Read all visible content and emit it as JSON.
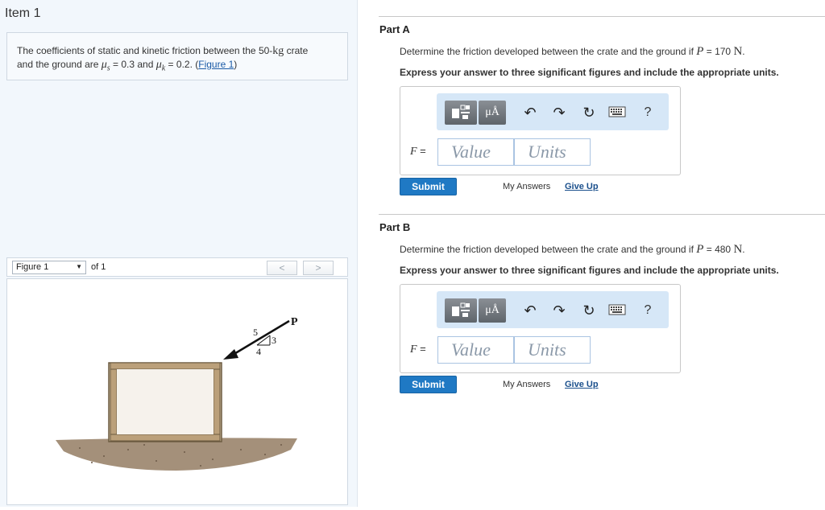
{
  "item_title": "Item 1",
  "problem": {
    "text_1": "The coefficients of static and kinetic friction between the 50-",
    "mass_unit": "kg",
    "text_2": " crate",
    "text_3": "and the ground are ",
    "mu_s_symbol": "μ",
    "mu_s_sub": "s",
    "mu_s_value": " = 0.3 and ",
    "mu_k_symbol": "μ",
    "mu_k_sub": "k",
    "mu_k_value": " = 0.2. (",
    "figure_link": "Figure 1",
    "close_paren": ")"
  },
  "figure_nav": {
    "selected": "Figure 1",
    "of_text": "of 1",
    "prev_label": "<",
    "next_label": ">"
  },
  "figure_labels": {
    "force": "P",
    "slope_hyp": "5",
    "slope_rise": "3",
    "slope_run": "4"
  },
  "parts": [
    {
      "title": "Part A",
      "question_prefix": "Determine the friction developed between the crate and the ground if ",
      "force_symbol": "P",
      "question_value": " = 170 ",
      "unit": "N",
      "period": ".",
      "instruction": "Express your answer to three significant figures and include the appropriate units.",
      "var_symbol": "F",
      "var_eq": " =",
      "value_placeholder": "Value",
      "units_placeholder": "Units",
      "submit_label": "Submit",
      "my_answers_label": "My Answers",
      "give_up_label": "Give Up"
    },
    {
      "title": "Part B",
      "question_prefix": "Determine the friction developed between the crate and the ground if ",
      "force_symbol": "P",
      "question_value": " = 480 ",
      "unit": "N",
      "period": ".",
      "instruction": "Express your answer to three significant figures and include the appropriate units.",
      "var_symbol": "F",
      "var_eq": " =",
      "value_placeholder": "Value",
      "units_placeholder": "Units",
      "submit_label": "Submit",
      "my_answers_label": "My Answers",
      "give_up_label": "Give Up"
    }
  ],
  "toolbar": {
    "units_button_label": "μÅ",
    "help_label": "?",
    "icons": [
      "templates-icon",
      "units-icon",
      "undo-icon",
      "redo-icon",
      "reset-icon",
      "keyboard-icon",
      "help-icon"
    ]
  },
  "colors": {
    "accent": "#1f79c4",
    "toolbar_bg": "#d6e7f7",
    "left_pane_bg": "#f2f7fc"
  }
}
